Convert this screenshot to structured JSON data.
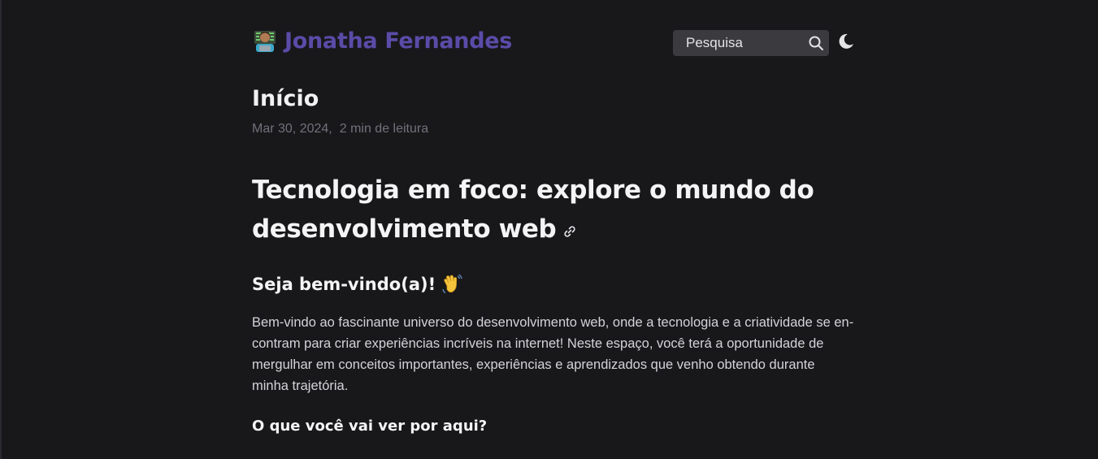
{
  "header": {
    "brand_name": "Jonatha Fernandes",
    "brand_icon": "technologist-emoji-icon",
    "search_placeholder": "Pesquisa",
    "search_icon": "search-icon",
    "theme_icon": "moon-icon"
  },
  "page": {
    "title": "Início",
    "date": "Mar 30, 2024,",
    "reading_time": "2 min de leitura"
  },
  "article": {
    "heading": "Tecnologia em foco: explore o mundo do desenvolvimento web",
    "welcome_heading": "Seja bem-vindo(a)!",
    "intro": "Bem-vindo ao fascinante universo do desenvolvimento web, onde a tecnologia e a criatividade se en­contram para criar experiências incríveis na internet! Neste espaço, você terá a oportunidade de mer­gulhar em conceitos importantes, experiências e aprendizados que venho obtendo durante minha trajetória.",
    "subheading": "O que você vai ver por aqui?"
  },
  "colors": {
    "background": "#18181b",
    "brand": "#5b4ba8",
    "search_bg": "#3a3a3f",
    "muted": "#71717a"
  }
}
